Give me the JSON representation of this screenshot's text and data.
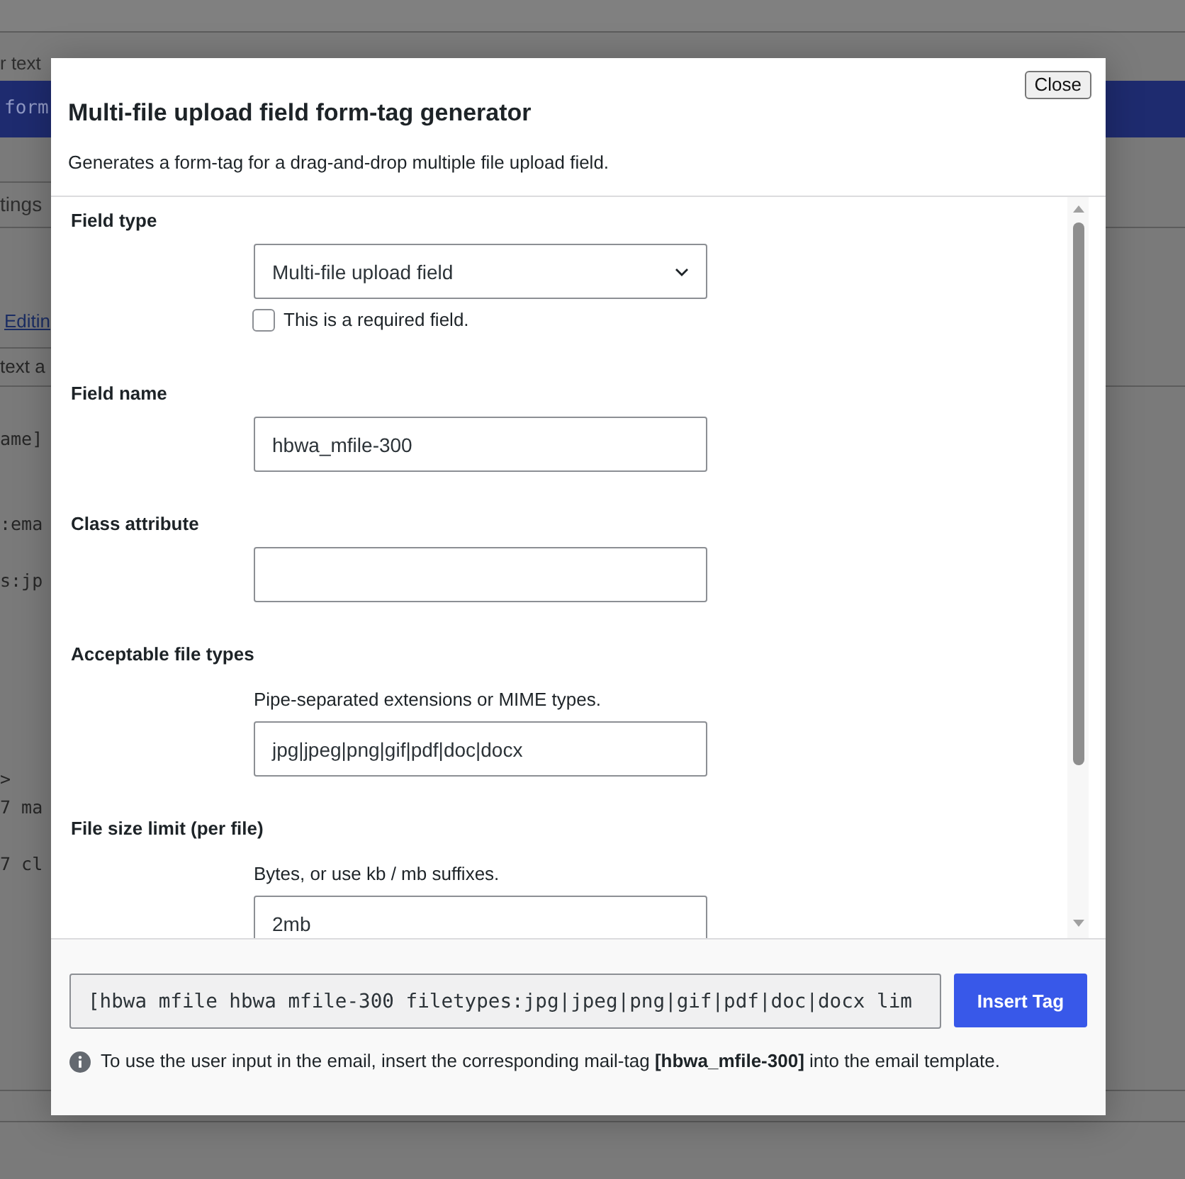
{
  "background_page": {
    "header_text": "r text",
    "title_bar_text": "form",
    "tab": "tings",
    "link": "Editin",
    "section_label": "text a",
    "code_lines": [
      "ame]",
      ":ema",
      "s:jp",
      ">",
      "7 ma",
      "7 cl"
    ]
  },
  "dialog": {
    "title": "Multi-file upload field form-tag generator",
    "description": "Generates a form-tag for a drag-and-drop multiple file upload field.",
    "close_button": "Close",
    "fields": [
      {
        "kind": "select",
        "label": "Field type",
        "value": "Multi-file upload field",
        "required": {
          "label": "This is a required field.",
          "checked": false
        }
      },
      {
        "kind": "text",
        "label": "Field name",
        "value": "hbwa_mfile-300"
      },
      {
        "kind": "text",
        "label": "Class attribute"
      },
      {
        "kind": "text",
        "label": "Acceptable file types",
        "hint": "Pipe-separated extensions or MIME types.",
        "value": "jpg|jpeg|png|gif|pdf|doc|docx"
      },
      {
        "kind": "text",
        "label": "File size limit (per file)",
        "hint": "Bytes, or use kb / mb suffixes.",
        "value": "2mb"
      }
    ],
    "tag_code": "[hbwa mfile hbwa mfile-300 filetypes:jpg|jpeg|png|gif|pdf|doc|docx lim",
    "insert_button": "Insert Tag",
    "note": "To use the user input in the email, insert the corresponding mail-tag **[hbwa_mfile-300]** into the email template."
  }
}
